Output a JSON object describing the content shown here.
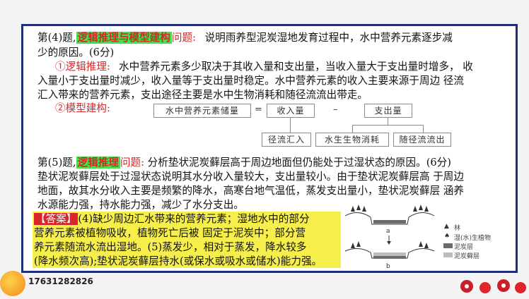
{
  "q4": {
    "label": "第(4)题,",
    "tag": "逻辑推理与模型建构",
    "word": "问题",
    "colon": ":",
    "question_l1": "说明雨养型泥炭湿地发育过程中，水中营养元素逐步减",
    "question_l2": "少的原因。(6分)",
    "reasoning_label": "①逻辑推理:",
    "reasoning_l1": "水中营养元素多少取决于其收入量和支出量，当收入量大于支出量时增多，  收",
    "reasoning_l2": "入量小于支出量时减少，收入量等于支出量时稳定。水中营养元素的收入主要来源于周边  径流",
    "reasoning_l3": "汇入带来的营养元素，支出途径主要是水中生物消耗和随径流流出带走。",
    "model_label": "②模型建构:"
  },
  "diagram": {
    "storage": "水中营养元素储量",
    "equals": "=",
    "income": "收入量",
    "minus": "–",
    "expense": "支出量",
    "runoff_in": "径流汇入",
    "bio_use": "水生生物消耗",
    "runoff_out": "随径流流出"
  },
  "q5": {
    "label": "第(5)题,",
    "tag": "逻辑推理",
    "word": "问题",
    "colon": ":",
    "question_l1": "分析垫状泥炭藓层高于周边地面但仍能处于过湿状态的原因。(6分)",
    "body_l1": "垫状泥炭藓层处于过湿状态说明其水分收入量较大，支出量较小。由于垫状泥炭藓层高  于周边",
    "body_l2": "地面，故其水分收入主要是频繁的降水，高寒台地气温低，蒸发支出量小，垫状泥炭藓层  涵养",
    "body_l3": "水源能力强，持水能力强，减少了水分支出。"
  },
  "answer": {
    "tag": "【答案】",
    "l1": "(4)缺少周边汇水带来的营养元素；湿地水中的部分",
    "l2": "营养元素被植物吸收，植物死亡后被  固定于泥炭中；部分营",
    "l3": "养元素随流水流出湿地。(5)蒸发少，相对于蒸发，降水较多",
    "l4": "(降水频次高);垫状泥炭藓层持水(或保水或吸水或储水)能力强。"
  },
  "figure": {
    "label_a": "a",
    "label_b": "b",
    "legend": [
      {
        "symbol": "tree",
        "text": "林"
      },
      {
        "symbol": "plant",
        "text": "湿(水)生植物"
      },
      {
        "symbol": "peat",
        "text": "泥炭层",
        "color": "#6b6b6b"
      },
      {
        "symbol": "moss",
        "text": "泥炭藓层",
        "color": "#bdbdbd"
      }
    ]
  },
  "footer": {
    "phone": "17631282826"
  }
}
